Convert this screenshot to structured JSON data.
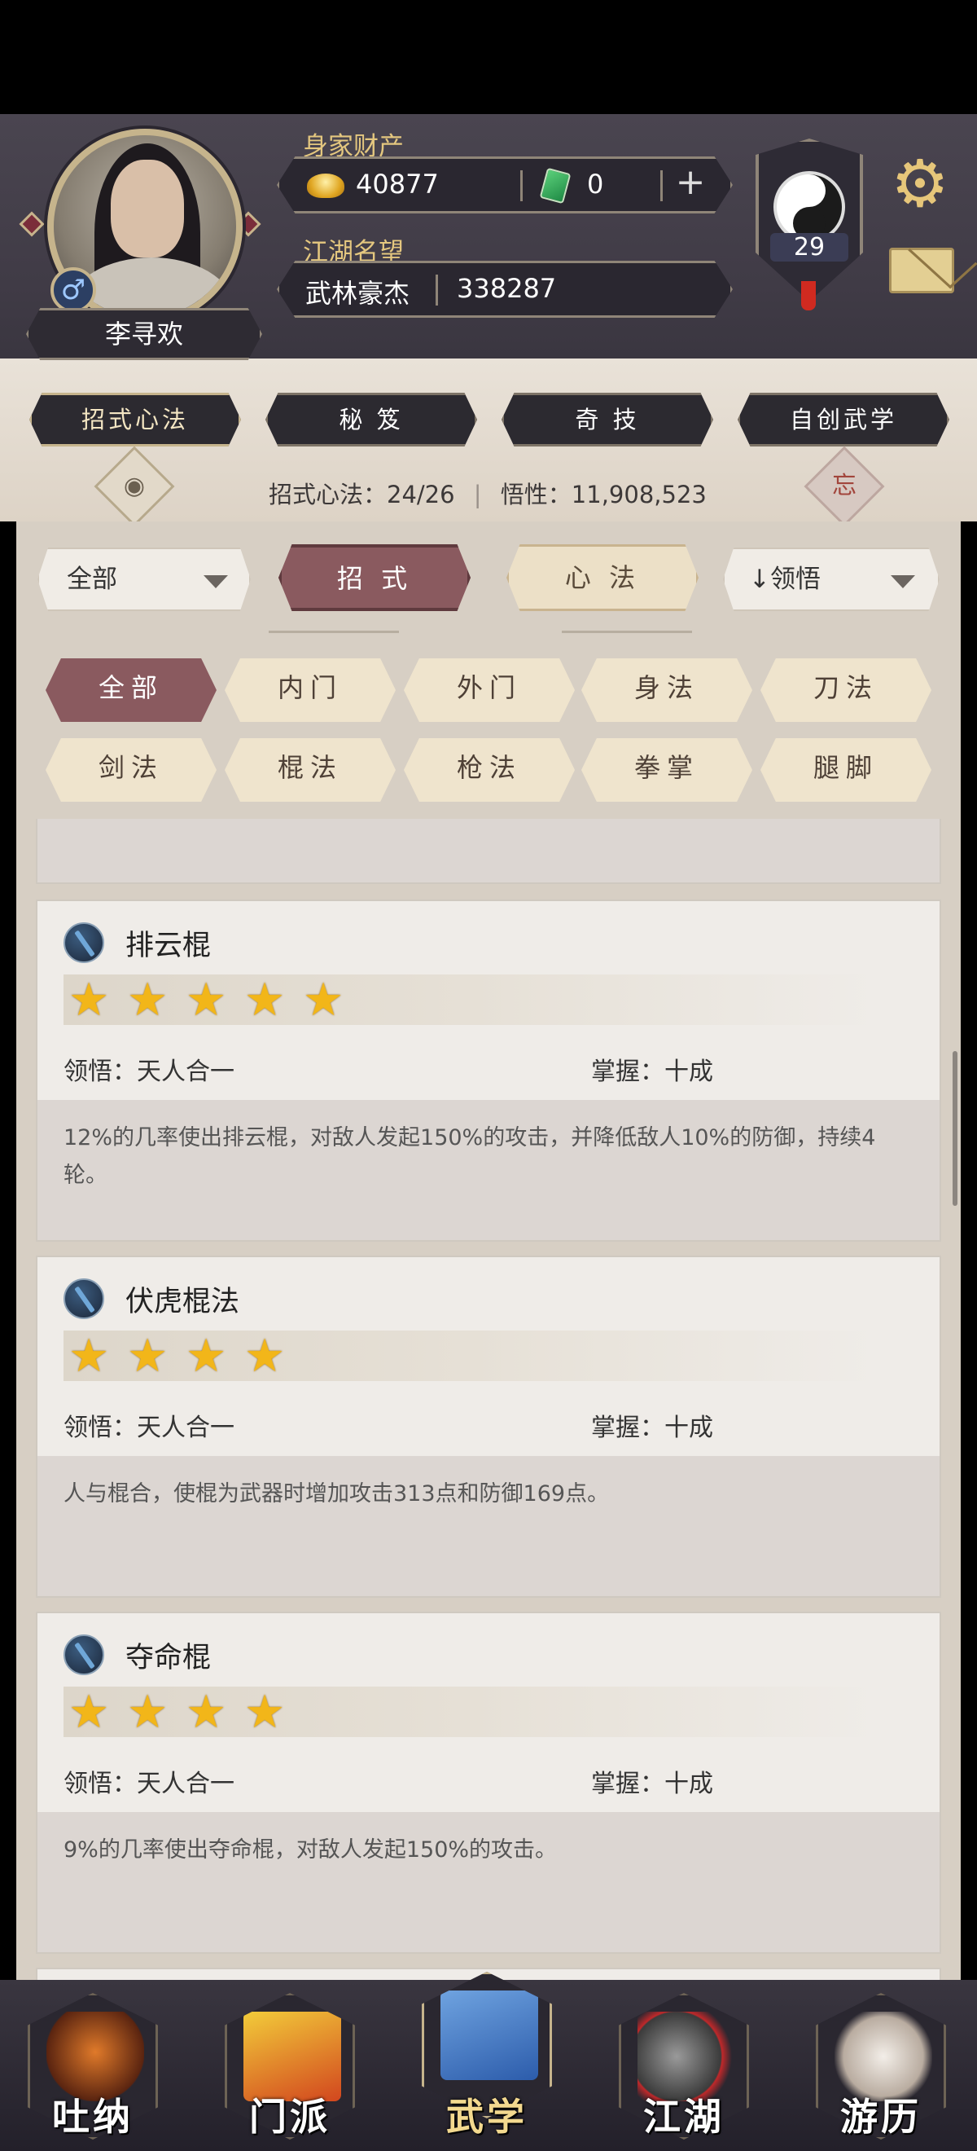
{
  "player": {
    "name": "李寻欢",
    "gender_symbol": "♂",
    "wealth_label": "身家财产",
    "gold": "40877",
    "jade": "0",
    "reputation_label": "江湖名望",
    "title": "武林豪杰",
    "reputation": "338287",
    "level": "29"
  },
  "icons": {
    "settings": "gear-icon",
    "mail": "mail-icon",
    "yinyang": "yinyang-icon",
    "add": "+"
  },
  "main_tabs": [
    "招式心法",
    "秘 笈",
    "奇 技",
    "自创武学"
  ],
  "stats": {
    "skills_label": "招式心法：24/26",
    "insight_label": "悟性：11,908,523",
    "eye_glyph": "◉",
    "forget_glyph": "忘"
  },
  "filters": {
    "scope": "全部",
    "sort": "↓领悟",
    "types": [
      "招 式",
      "心 法"
    ],
    "categories": [
      "全部",
      "内门",
      "外门",
      "身法",
      "刀法",
      "剑法",
      "棍法",
      "枪法",
      "拳掌",
      "腿脚"
    ]
  },
  "skills": [
    {
      "name": "排云棍",
      "stars": 5,
      "comprehension": "领悟：天人合一",
      "mastery": "掌握：十成",
      "desc": "12%的几率使出排云棍，对敌人发起150%的攻击，并降低敌人10%的防御，持续4轮。"
    },
    {
      "name": "伏虎棍法",
      "stars": 4,
      "comprehension": "领悟：天人合一",
      "mastery": "掌握：十成",
      "desc": "人与棍合，使棍为武器时增加攻击313点和防御169点。"
    },
    {
      "name": "夺命棍",
      "stars": 4,
      "comprehension": "领悟：天人合一",
      "mastery": "掌握：十成",
      "desc": "9%的几率使出夺命棍，对敌人发起150%的攻击。"
    }
  ],
  "bottom_nav": [
    "吐纳",
    "门派",
    "武学",
    "江湖",
    "游历"
  ],
  "colors": {
    "accent": "#8a5a5f",
    "gold_text": "#e4c77f",
    "header_bg": "#4a4550"
  }
}
